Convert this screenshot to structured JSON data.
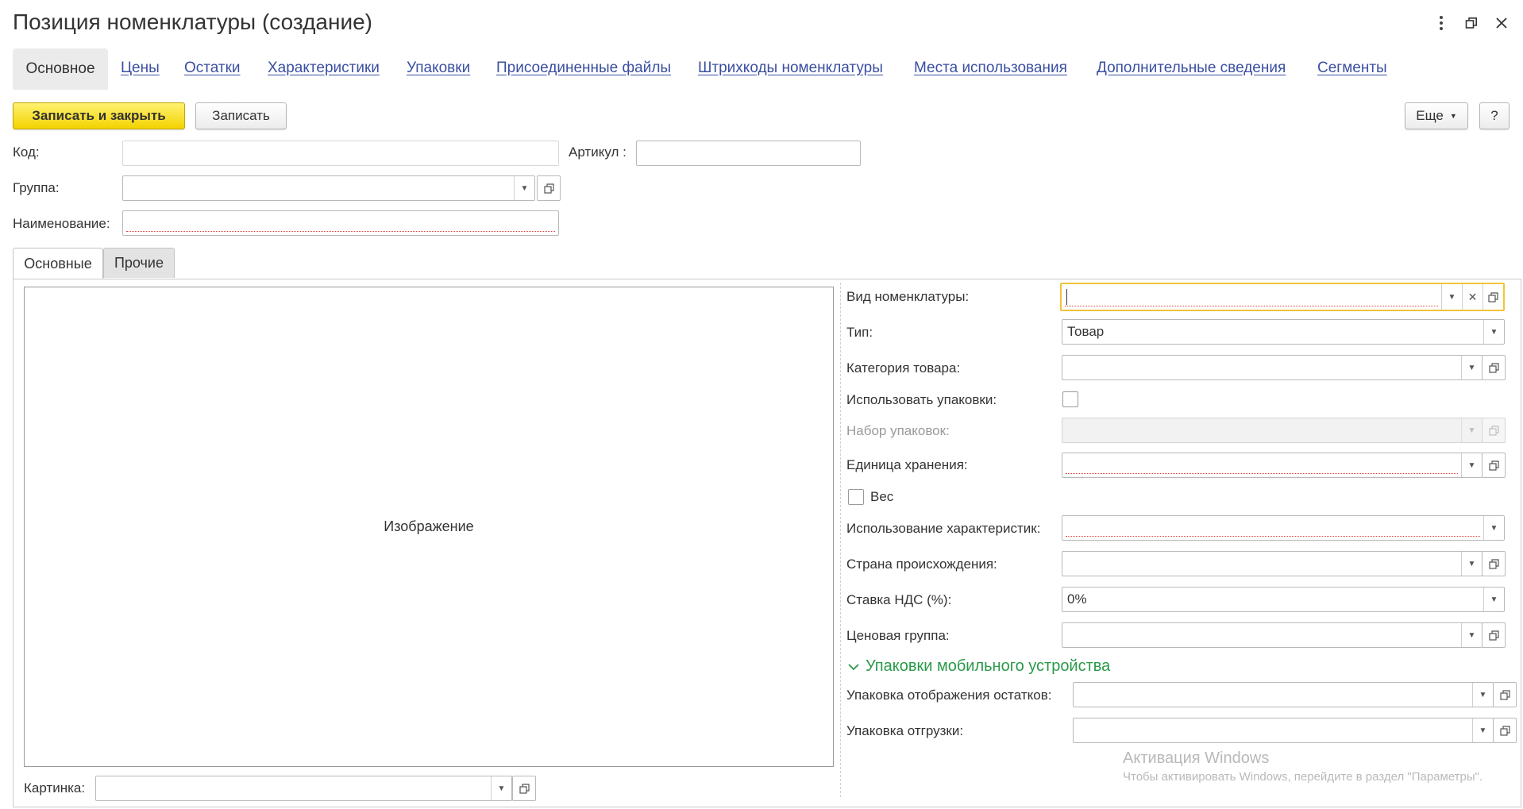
{
  "window": {
    "title": "Позиция номенклатуры (создание)",
    "menu_icon": "more-vertical-icon",
    "restore_icon": "restore-window-icon",
    "close_icon": "close-icon"
  },
  "nav": {
    "active": "Основное",
    "links": [
      "Цены",
      "Остатки",
      "Характеристики",
      "Упаковки",
      "Присоединенные файлы",
      "Штрихкоды номенклатуры",
      "Места использования",
      "Дополнительные сведения",
      "Сегменты"
    ]
  },
  "toolbar": {
    "save_close": "Записать и закрыть",
    "save": "Записать",
    "more": "Еще",
    "help": "?"
  },
  "header_fields": {
    "code_label": "Код:",
    "code_value": "",
    "article_label": "Артикул :",
    "article_value": "",
    "group_label": "Группа:",
    "group_value": "",
    "name_label": "Наименование:",
    "name_value": ""
  },
  "tabs": [
    "Основные",
    "Прочие"
  ],
  "image": {
    "placeholder": "Изображение",
    "picture_label": "Картинка:",
    "picture_value": ""
  },
  "form": {
    "kind_label": "Вид номенклатуры:",
    "kind_value": "",
    "type_label": "Тип:",
    "type_value": "Товар",
    "category_label": "Категория товара:",
    "category_value": "",
    "use_packages_label": "Использовать упаковки:",
    "use_packages_checked": false,
    "package_set_label": "Набор упаковок:",
    "package_set_value": "",
    "unit_label": "Единица хранения:",
    "unit_value": "",
    "weight_label": "Вес",
    "weight_checked": false,
    "characteristics_label": "Использование характеристик:",
    "characteristics_value": "",
    "country_label": "Страна происхождения:",
    "country_value": "",
    "vat_label": "Ставка НДС (%):",
    "vat_value": "0%",
    "price_group_label": "Ценовая группа:",
    "price_group_value": ""
  },
  "mobile_group": {
    "title": "Упаковки мобильного устройства",
    "stock_pack_label": "Упаковка отображения остатков:",
    "stock_pack_value": "",
    "ship_pack_label": "Упаковка отгрузки:",
    "ship_pack_value": ""
  },
  "watermark": {
    "title": "Активация Windows",
    "subtitle": "Чтобы активировать Windows, перейдите в раздел \"Параметры\"."
  },
  "colors": {
    "primary_button": "#f3d300",
    "link": "#3a4fa1",
    "group_title": "#2a9a4a",
    "focus_border": "#f0c43a",
    "required_underline": "#e0413e"
  }
}
